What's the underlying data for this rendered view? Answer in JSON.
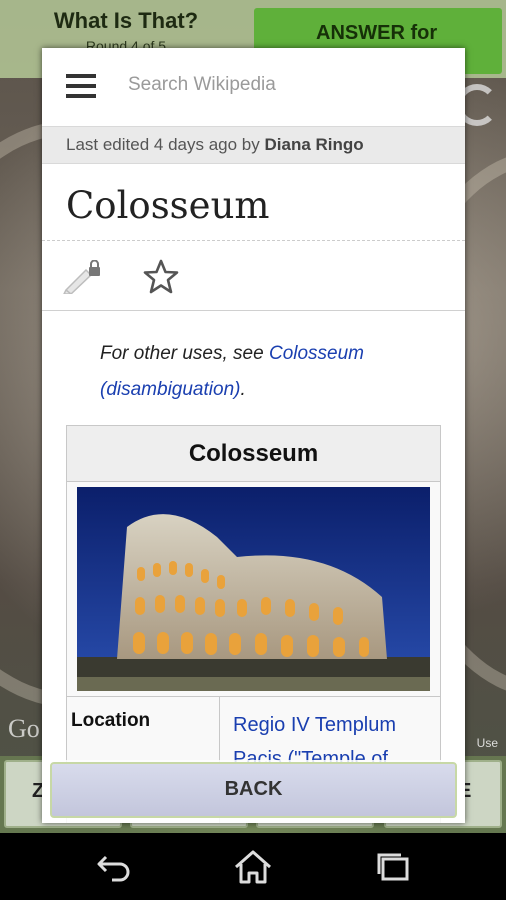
{
  "game": {
    "title": "What Is That?",
    "round": "Round 4 of 5",
    "answer_label": "ANSWER for",
    "map_logo": "Go",
    "terms": "Use",
    "choices": [
      "Z",
      "",
      "",
      "E"
    ]
  },
  "wiki": {
    "search_placeholder": "Search Wikipedia",
    "edited_prefix": "Last edited 4 days ago by ",
    "edited_user": "Diana Ringo",
    "page_title": "Colosseum",
    "hatnote_prefix": "For other uses, see ",
    "hatnote_link": "Colosseum (disambiguation)",
    "hatnote_suffix": ".",
    "infobox": {
      "title": "Colosseum",
      "row_label": "Location",
      "row_value": "Regio IV Templum Pacis (\"Temple of"
    }
  },
  "back_label": "BACK",
  "icons": {
    "menu": "hamburger-menu-icon",
    "edit": "pencil-lock-icon",
    "watch": "star-icon",
    "nav_back": "back-arrow-icon",
    "nav_home": "home-icon",
    "nav_recents": "recents-icon"
  }
}
